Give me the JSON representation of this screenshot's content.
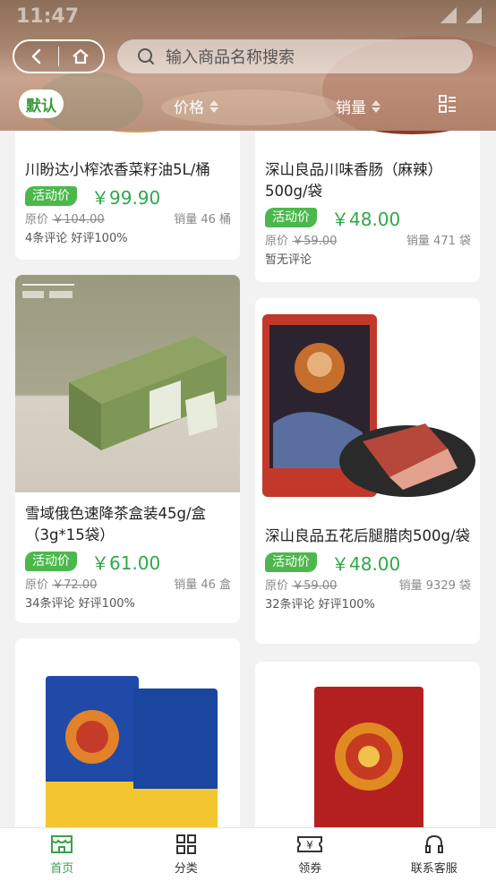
{
  "status_bar": {
    "time": "11:47"
  },
  "header": {
    "search_placeholder": "输入商品名称搜索",
    "sort": {
      "default_label": "默认",
      "price_label": "价格",
      "sales_label": "销量"
    }
  },
  "products": [
    {
      "title": "川盼达小榨浓香菜籽油5L/桶",
      "tag": "活动价",
      "price": "￥99.90",
      "orig_prefix": "原价",
      "orig_price": "￥104.00",
      "sales": "销量 46 桶",
      "reviews": "4条评论 好评100%"
    },
    {
      "title": "深山良品川味香肠（麻辣）500g/袋",
      "tag": "活动价",
      "price": "￥48.00",
      "orig_prefix": "原价",
      "orig_price": "￥59.00",
      "sales": "销量 471 袋",
      "reviews": "暂无评论"
    },
    {
      "title": "雪域俄色速降茶盒装45g/盒（3g*15袋）",
      "tag": "活动价",
      "price": "￥61.00",
      "orig_prefix": "原价",
      "orig_price": "￥72.00",
      "sales": "销量 46 盒",
      "reviews": "34条评论 好评100%"
    },
    {
      "title": "深山良品五花后腿腊肉500g/袋",
      "tag": "活动价",
      "price": "￥48.00",
      "orig_prefix": "原价",
      "orig_price": "￥59.00",
      "sales": "销量 9329 袋",
      "reviews": "32条评论 好评100%"
    },
    {
      "title": "",
      "tag": "",
      "price": "",
      "orig_prefix": "",
      "orig_price": "",
      "sales": "",
      "reviews": ""
    },
    {
      "title": "",
      "tag": "",
      "price": "",
      "orig_prefix": "",
      "orig_price": "",
      "sales": "",
      "reviews": ""
    }
  ],
  "tabbar": [
    {
      "label": "首页",
      "icon": "shop-icon",
      "active": true
    },
    {
      "label": "分类",
      "icon": "grid-icon",
      "active": false
    },
    {
      "label": "领券",
      "icon": "coupon-icon",
      "active": false
    },
    {
      "label": "联系客服",
      "icon": "headset-icon",
      "active": false
    }
  ],
  "colors": {
    "accent": "#3aa04a",
    "tag": "#4cb84c",
    "price": "#2fa84a"
  }
}
